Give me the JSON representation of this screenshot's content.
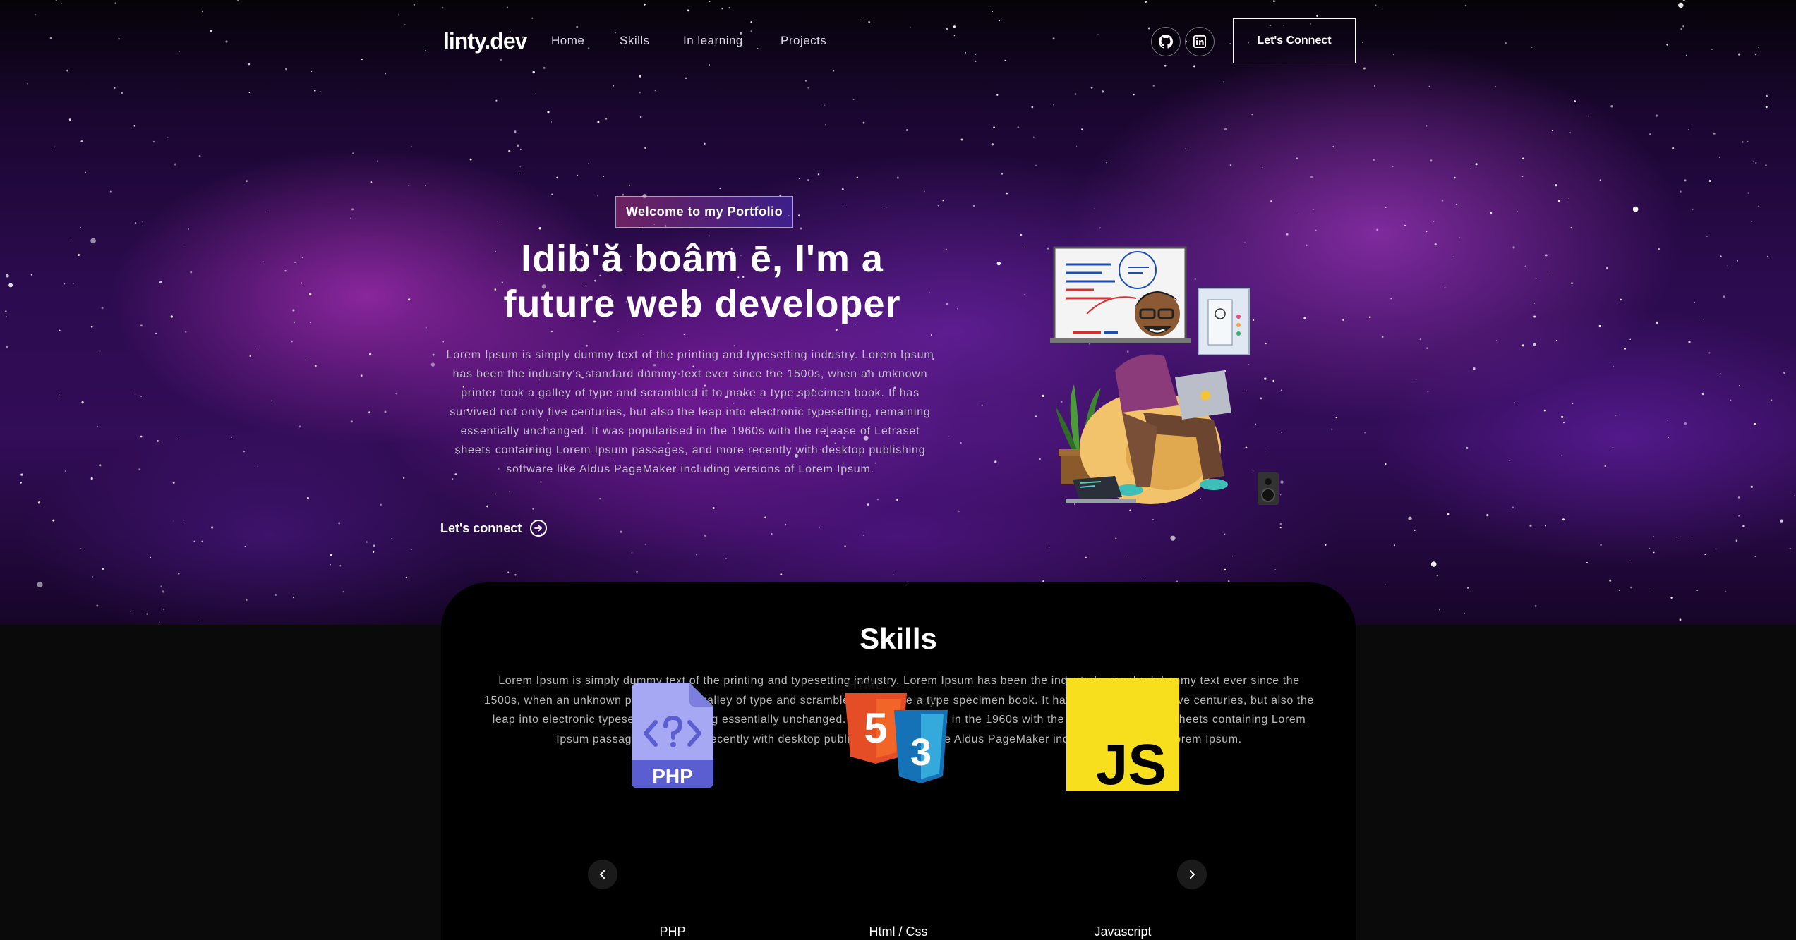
{
  "nav": {
    "logo": "linty.dev",
    "links": [
      "Home",
      "Skills",
      "In learning",
      "Projects"
    ],
    "social": [
      {
        "icon": "github-icon"
      },
      {
        "icon": "linkedin-icon"
      }
    ],
    "connect_label": "Let's Connect"
  },
  "hero": {
    "tagline": "Welcome to my Portfolio",
    "headline_line1": "Idib'ă boâm ē, I'm a",
    "headline_line2": "future web developer",
    "intro": "Lorem Ipsum is simply dummy text of the printing and typesetting industry. Lorem Ipsum has been the industry's standard dummy text ever since the 1500s, when an unknown printer took a galley of type and scrambled it to make a type specimen book. It has survived not only five centuries, but also the leap into electronic typesetting, remaining essentially unchanged. It was popularised in the 1960s with the release of Letraset sheets containing Lorem Ipsum passages, and more recently with desktop publishing software like Aldus PageMaker including versions of Lorem Ipsum.",
    "cta_label": "Let's connect"
  },
  "skills": {
    "title": "Skills",
    "description": "Lorem Ipsum is simply dummy text of the printing and typesetting industry. Lorem Ipsum has been the industry's standard dummy text ever since the 1500s, when an unknown printer took a galley of type and scrambled it to make a type specimen book. It has survived not only five centuries, but also the leap into electronic typesetting, remaining essentially unchanged. It was popularised in the 1960s with the release of Letraset sheets containing Lorem Ipsum passages, and more recently with desktop publishing software like Aldus PageMaker including versions of Lorem Ipsum.",
    "items": [
      {
        "label": "PHP",
        "icon": "php-file-icon",
        "badge": "PHP"
      },
      {
        "label": "Html / Css",
        "icon": "html-css-icon",
        "html_num": "5",
        "css_num": "3",
        "html_tag": "HTML",
        "css_tag": "CSS"
      },
      {
        "label": "Javascript",
        "icon": "javascript-icon",
        "badge": "JS"
      }
    ]
  },
  "colors": {
    "background": "#0a0a0a",
    "skills_panel": "#000000",
    "tagline_gradient_start": "#aa367c",
    "tagline_gradient_end": "#4a2fbd"
  }
}
